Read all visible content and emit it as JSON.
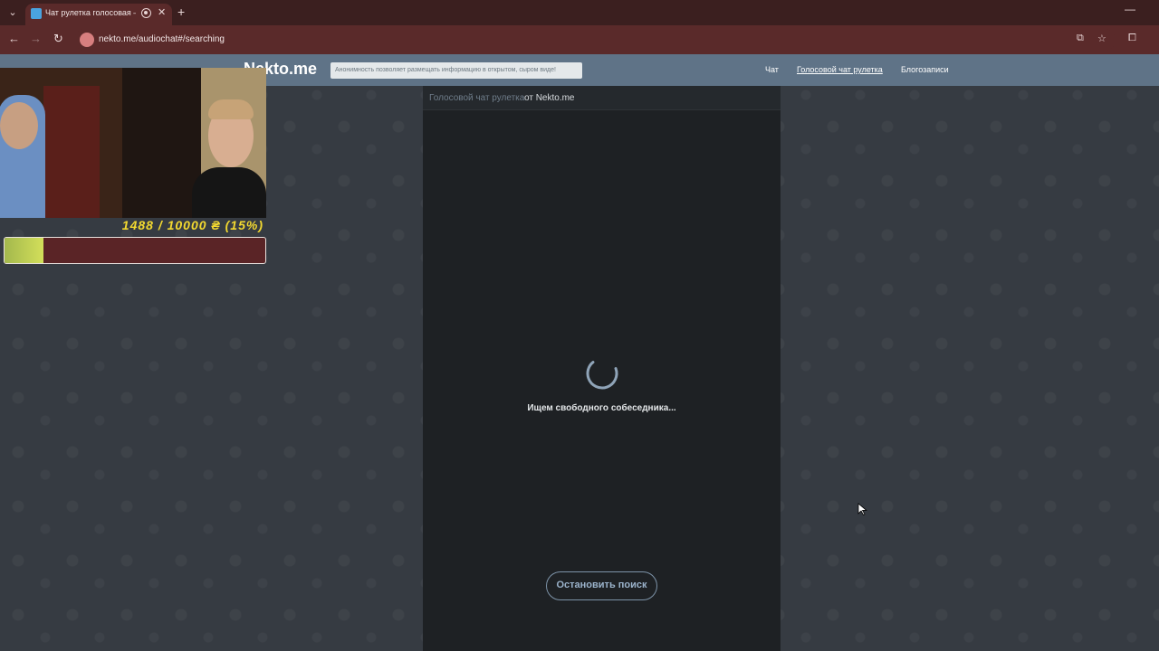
{
  "browser": {
    "tab_title": "Чат рулетка голосовая — ",
    "url": "nekto.me/audiochat#/searching",
    "icons": {
      "tab_menu": "chevron-down-icon",
      "tab_close": "close-icon",
      "new_tab": "plus-icon",
      "back": "arrow-left-icon",
      "forward": "arrow-right-icon",
      "reload": "reload-icon",
      "install": "install-icon",
      "bookmark": "star-icon",
      "extensions": "puzzle-icon"
    }
  },
  "site": {
    "logo": "Nekto.me",
    "notice": "Анонимность позволяет размещать информацию в открытом, сыром виде!",
    "nav": {
      "chat": "Чат",
      "voice_chat": "Голосовой чат рулетка",
      "blogs": "Блогозаписи"
    }
  },
  "panel": {
    "title_link": "Голосовой чат рулетка",
    "title_from": "от Nekto.me",
    "status": "Ищем свободного собеседника...",
    "stop_button": "Остановить поиск"
  },
  "overlay": {
    "donation_text": "1488 / 10000 ₴ (15%)",
    "progress_fraction": 0.15,
    "colors": {
      "text": "#f3d930",
      "bar_bg": "#5a2426",
      "bar_fill": "#c4d155"
    }
  },
  "colors": {
    "header": "#5f7387",
    "panel": "#1e2124",
    "background": "#363b42",
    "button_border": "#7d93a8"
  }
}
